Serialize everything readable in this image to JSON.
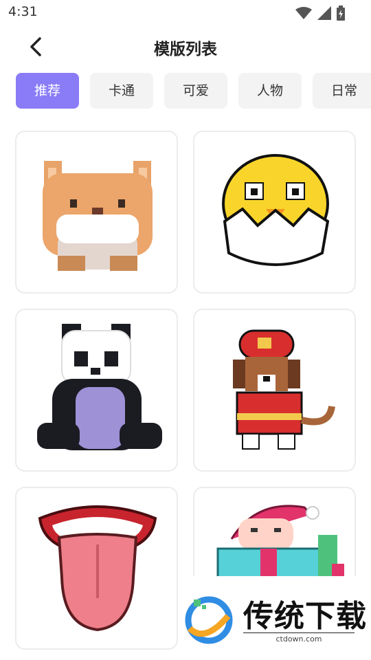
{
  "status_bar": {
    "time": "4:31"
  },
  "header": {
    "title": "模版列表"
  },
  "tabs": [
    {
      "label": "推荐",
      "active": true
    },
    {
      "label": "卡通",
      "active": false
    },
    {
      "label": "可爱",
      "active": false
    },
    {
      "label": "人物",
      "active": false
    },
    {
      "label": "日常",
      "active": false
    }
  ],
  "templates": [
    {
      "icon": "pixel-cat-icon"
    },
    {
      "icon": "pixel-chick-icon"
    },
    {
      "icon": "pixel-panda-icon"
    },
    {
      "icon": "pixel-firefighter-dog-icon"
    },
    {
      "icon": "pixel-mouth-tongue-icon"
    },
    {
      "icon": "pixel-gift-girl-icon"
    }
  ],
  "watermark": {
    "text": "传统下载",
    "url": "ctdown.com"
  },
  "colors": {
    "accent": "#8a7cf7",
    "tab_bg": "#f3f3f3"
  }
}
